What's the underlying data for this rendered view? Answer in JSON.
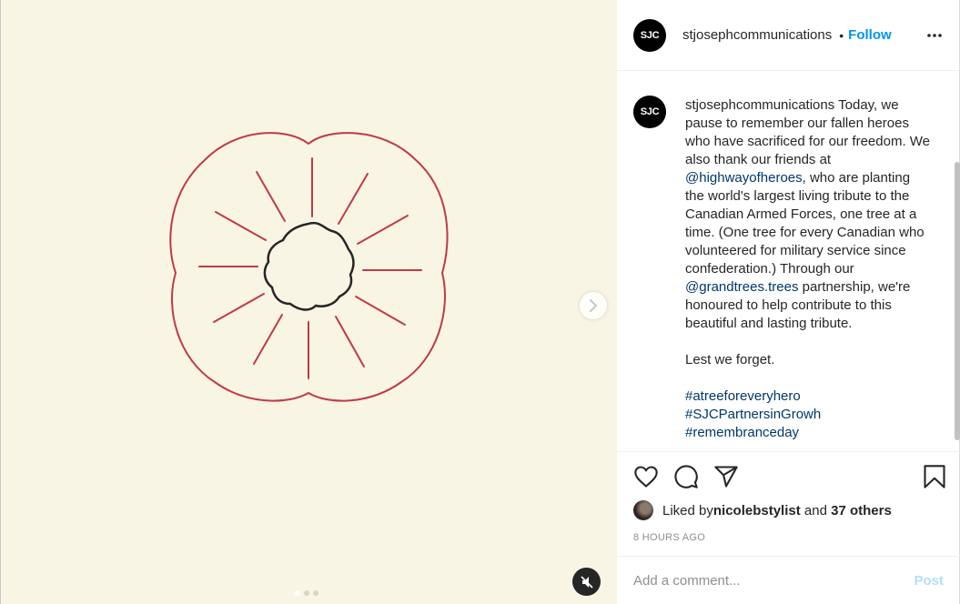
{
  "header": {
    "avatar_text": "SJC",
    "username": "stjosephcommunications",
    "separator": "•",
    "follow_label": "Follow"
  },
  "caption": {
    "avatar_text": "SJC",
    "username": "stjosephcommunications",
    "text_1": " Today, we pause to remember our fallen heroes who have sacrificed for our freedom. We also thank our friends at ",
    "mention_1": "@highwayofheroes",
    "text_2": ", who are planting the world's largest living tribute to the Canadian Armed Forces, one tree at a time. (One tree for every Canadian who volunteered for military service since confederation.) Through our ",
    "mention_2": "@grandtrees.trees",
    "text_3": " partnership, we're honoured to help contribute to this beautiful and lasting tribute.\n\nLest we forget.\n\n",
    "hashtag_1": "#atreeforeveryhero",
    "hashtag_2": "#SJCPartnersinGrowh",
    "hashtag_3": "#remembranceday"
  },
  "likes": {
    "prefix": "Liked by ",
    "user": "nicolebstylist",
    "middle": " and ",
    "others": "37 others"
  },
  "timestamp": "8 HOURS AGO",
  "comment": {
    "placeholder": "Add a comment...",
    "post_label": "Post"
  },
  "media": {
    "slide_count": 3,
    "active_slide": 1
  },
  "icons": [
    "more-icon",
    "heart-icon",
    "comment-icon",
    "share-icon",
    "bookmark-icon",
    "next-arrow-icon",
    "muted-speaker-icon"
  ],
  "colors": {
    "media_bg": "#f8f5e4",
    "poppy_red": "#c0394a",
    "poppy_center": "#262626",
    "link": "#00376b",
    "follow": "#0095f6",
    "post_disabled": "#b2dffc"
  }
}
